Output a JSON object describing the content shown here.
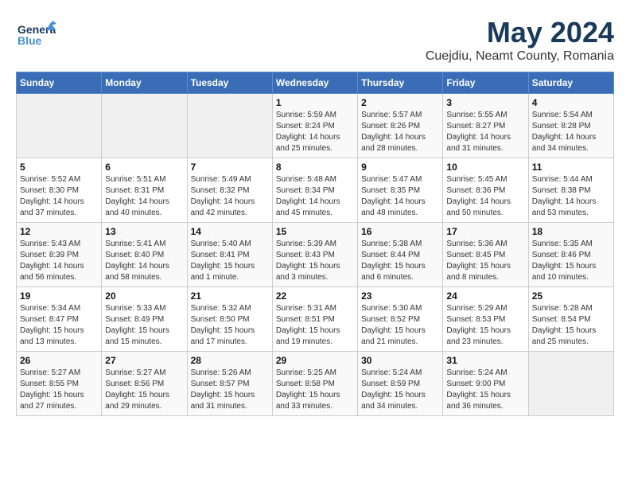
{
  "header": {
    "logo_general": "General",
    "logo_blue": "Blue",
    "month_title": "May 2024",
    "subtitle": "Cuejdiu, Neamt County, Romania"
  },
  "days_of_week": [
    "Sunday",
    "Monday",
    "Tuesday",
    "Wednesday",
    "Thursday",
    "Friday",
    "Saturday"
  ],
  "weeks": [
    [
      {
        "day": "",
        "empty": true
      },
      {
        "day": "",
        "empty": true
      },
      {
        "day": "",
        "empty": true
      },
      {
        "day": "1",
        "sunrise": "Sunrise: 5:59 AM",
        "sunset": "Sunset: 8:24 PM",
        "daylight": "Daylight: 14 hours and 25 minutes."
      },
      {
        "day": "2",
        "sunrise": "Sunrise: 5:57 AM",
        "sunset": "Sunset: 8:26 PM",
        "daylight": "Daylight: 14 hours and 28 minutes."
      },
      {
        "day": "3",
        "sunrise": "Sunrise: 5:55 AM",
        "sunset": "Sunset: 8:27 PM",
        "daylight": "Daylight: 14 hours and 31 minutes."
      },
      {
        "day": "4",
        "sunrise": "Sunrise: 5:54 AM",
        "sunset": "Sunset: 8:28 PM",
        "daylight": "Daylight: 14 hours and 34 minutes."
      }
    ],
    [
      {
        "day": "5",
        "sunrise": "Sunrise: 5:52 AM",
        "sunset": "Sunset: 8:30 PM",
        "daylight": "Daylight: 14 hours and 37 minutes."
      },
      {
        "day": "6",
        "sunrise": "Sunrise: 5:51 AM",
        "sunset": "Sunset: 8:31 PM",
        "daylight": "Daylight: 14 hours and 40 minutes."
      },
      {
        "day": "7",
        "sunrise": "Sunrise: 5:49 AM",
        "sunset": "Sunset: 8:32 PM",
        "daylight": "Daylight: 14 hours and 42 minutes."
      },
      {
        "day": "8",
        "sunrise": "Sunrise: 5:48 AM",
        "sunset": "Sunset: 8:34 PM",
        "daylight": "Daylight: 14 hours and 45 minutes."
      },
      {
        "day": "9",
        "sunrise": "Sunrise: 5:47 AM",
        "sunset": "Sunset: 8:35 PM",
        "daylight": "Daylight: 14 hours and 48 minutes."
      },
      {
        "day": "10",
        "sunrise": "Sunrise: 5:45 AM",
        "sunset": "Sunset: 8:36 PM",
        "daylight": "Daylight: 14 hours and 50 minutes."
      },
      {
        "day": "11",
        "sunrise": "Sunrise: 5:44 AM",
        "sunset": "Sunset: 8:38 PM",
        "daylight": "Daylight: 14 hours and 53 minutes."
      }
    ],
    [
      {
        "day": "12",
        "sunrise": "Sunrise: 5:43 AM",
        "sunset": "Sunset: 8:39 PM",
        "daylight": "Daylight: 14 hours and 56 minutes."
      },
      {
        "day": "13",
        "sunrise": "Sunrise: 5:41 AM",
        "sunset": "Sunset: 8:40 PM",
        "daylight": "Daylight: 14 hours and 58 minutes."
      },
      {
        "day": "14",
        "sunrise": "Sunrise: 5:40 AM",
        "sunset": "Sunset: 8:41 PM",
        "daylight": "Daylight: 15 hours and 1 minute."
      },
      {
        "day": "15",
        "sunrise": "Sunrise: 5:39 AM",
        "sunset": "Sunset: 8:43 PM",
        "daylight": "Daylight: 15 hours and 3 minutes."
      },
      {
        "day": "16",
        "sunrise": "Sunrise: 5:38 AM",
        "sunset": "Sunset: 8:44 PM",
        "daylight": "Daylight: 15 hours and 6 minutes."
      },
      {
        "day": "17",
        "sunrise": "Sunrise: 5:36 AM",
        "sunset": "Sunset: 8:45 PM",
        "daylight": "Daylight: 15 hours and 8 minutes."
      },
      {
        "day": "18",
        "sunrise": "Sunrise: 5:35 AM",
        "sunset": "Sunset: 8:46 PM",
        "daylight": "Daylight: 15 hours and 10 minutes."
      }
    ],
    [
      {
        "day": "19",
        "sunrise": "Sunrise: 5:34 AM",
        "sunset": "Sunset: 8:47 PM",
        "daylight": "Daylight: 15 hours and 13 minutes."
      },
      {
        "day": "20",
        "sunrise": "Sunrise: 5:33 AM",
        "sunset": "Sunset: 8:49 PM",
        "daylight": "Daylight: 15 hours and 15 minutes."
      },
      {
        "day": "21",
        "sunrise": "Sunrise: 5:32 AM",
        "sunset": "Sunset: 8:50 PM",
        "daylight": "Daylight: 15 hours and 17 minutes."
      },
      {
        "day": "22",
        "sunrise": "Sunrise: 5:31 AM",
        "sunset": "Sunset: 8:51 PM",
        "daylight": "Daylight: 15 hours and 19 minutes."
      },
      {
        "day": "23",
        "sunrise": "Sunrise: 5:30 AM",
        "sunset": "Sunset: 8:52 PM",
        "daylight": "Daylight: 15 hours and 21 minutes."
      },
      {
        "day": "24",
        "sunrise": "Sunrise: 5:29 AM",
        "sunset": "Sunset: 8:53 PM",
        "daylight": "Daylight: 15 hours and 23 minutes."
      },
      {
        "day": "25",
        "sunrise": "Sunrise: 5:28 AM",
        "sunset": "Sunset: 8:54 PM",
        "daylight": "Daylight: 15 hours and 25 minutes."
      }
    ],
    [
      {
        "day": "26",
        "sunrise": "Sunrise: 5:27 AM",
        "sunset": "Sunset: 8:55 PM",
        "daylight": "Daylight: 15 hours and 27 minutes."
      },
      {
        "day": "27",
        "sunrise": "Sunrise: 5:27 AM",
        "sunset": "Sunset: 8:56 PM",
        "daylight": "Daylight: 15 hours and 29 minutes."
      },
      {
        "day": "28",
        "sunrise": "Sunrise: 5:26 AM",
        "sunset": "Sunset: 8:57 PM",
        "daylight": "Daylight: 15 hours and 31 minutes."
      },
      {
        "day": "29",
        "sunrise": "Sunrise: 5:25 AM",
        "sunset": "Sunset: 8:58 PM",
        "daylight": "Daylight: 15 hours and 33 minutes."
      },
      {
        "day": "30",
        "sunrise": "Sunrise: 5:24 AM",
        "sunset": "Sunset: 8:59 PM",
        "daylight": "Daylight: 15 hours and 34 minutes."
      },
      {
        "day": "31",
        "sunrise": "Sunrise: 5:24 AM",
        "sunset": "Sunset: 9:00 PM",
        "daylight": "Daylight: 15 hours and 36 minutes."
      },
      {
        "day": "",
        "empty": true
      }
    ]
  ]
}
